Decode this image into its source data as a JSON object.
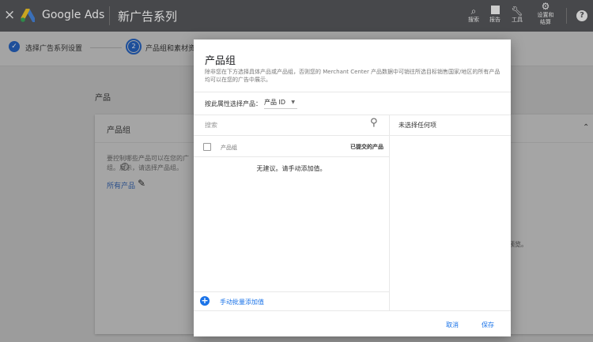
{
  "topbar": {
    "close": "×",
    "brand": "Google Ads",
    "title": "新广告系列",
    "icons": [
      {
        "icon": "search-icon",
        "label": "搜索"
      },
      {
        "icon": "reports-icon",
        "label": "报告"
      },
      {
        "icon": "tools-icon",
        "label": "工具"
      },
      {
        "icon": "settings-icon",
        "label": "设置和",
        "label2": "结算"
      }
    ],
    "help": "?"
  },
  "stepper": {
    "step1": "选择广告系列设置",
    "step2_num": "2",
    "step2": "产品组和素材资源"
  },
  "background": {
    "section": "产品",
    "card_title": "产品组",
    "desc": "要控制哪些产品可以在您的广告中展示，请选择产品组。",
    "desc2": "组。",
    "link": "所有产品",
    "preview_tail": "预览。"
  },
  "dialog": {
    "title": "产品组",
    "description": "除非您在下方选择具体产品或产品组，否则您的 Merchant Center 产品数据中可销往所选目标销售国家/地区的所有产品均可以在您的广告中展示。",
    "attr_label": "按此属性选择产品：",
    "attr_value": "产品 ID",
    "search_placeholder": "搜索",
    "col_group": "产品组",
    "col_submitted": "已提交的产品",
    "empty": "无建议。请手动添加值。",
    "add_bulk": "手动批量添加值",
    "right_empty": "未选择任何项",
    "cancel": "取消",
    "save": "保存"
  },
  "colors": {
    "accent": "#1a73e8"
  }
}
